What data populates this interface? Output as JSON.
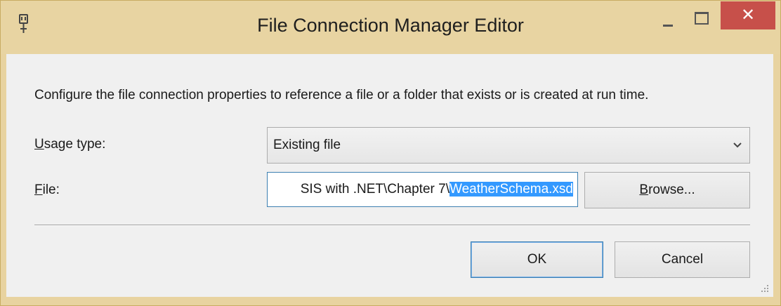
{
  "window": {
    "title": "File Connection Manager Editor",
    "close_symbol": "✕"
  },
  "description": "Configure the file connection properties to reference a file or a folder that exists or is created at run time.",
  "usage_type": {
    "label_mnemonic": "U",
    "label_rest": "sage type:",
    "selected": "Existing file"
  },
  "file": {
    "label_mnemonic": "F",
    "label_rest": "ile:",
    "value_unselected": "SIS with .NET\\Chapter 7\\",
    "value_selected": "WeatherSchema.xsd"
  },
  "buttons": {
    "browse_mnemonic": "B",
    "browse_rest": "rowse...",
    "ok": "OK",
    "cancel": "Cancel"
  },
  "icons": {
    "app": "connection-plug-icon",
    "minimize": "minimize-icon",
    "maximize": "maximize-icon",
    "close": "close-icon",
    "dropdown": "chevron-down-icon",
    "resize": "resize-grip-icon"
  },
  "colors": {
    "titlebar": "#e8d4a2",
    "close_button": "#c7504a",
    "selection": "#3399ff",
    "focus_border": "#3c7fb1",
    "client_background": "#f0f0f0"
  }
}
